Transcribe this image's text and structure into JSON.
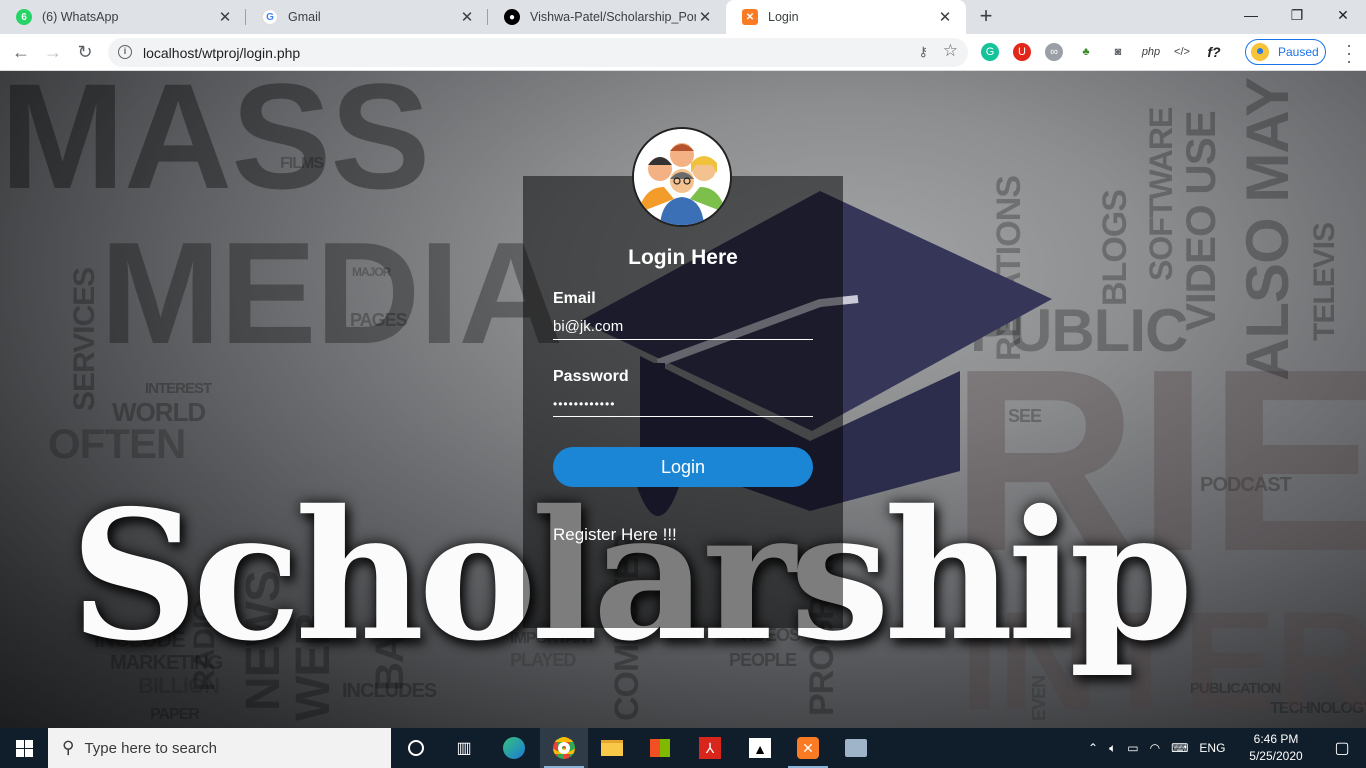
{
  "tabs": [
    {
      "title": "(6) WhatsApp",
      "icon": "whatsapp-icon",
      "badge": "6",
      "color": "#25d366"
    },
    {
      "title": "Gmail",
      "icon": "google-icon",
      "color": "#ffffff"
    },
    {
      "title": "Vishwa-Patel/Scholarship_Portal:",
      "icon": "github-icon",
      "color": "#000000"
    },
    {
      "title": "Login",
      "icon": "xampp-icon",
      "color": "#fb7a24"
    }
  ],
  "window": {
    "minimize": "—",
    "maximize": "❐",
    "close": "✕",
    "new_tab": "+"
  },
  "toolbar": {
    "url": "localhost/wtproj/login.php",
    "paused_label": "Paused",
    "extensions": [
      "grammarly-icon",
      "ublock-icon",
      "link-icon",
      "tree-icon",
      "camera-icon",
      "php",
      "code-icon",
      "f?"
    ]
  },
  "login": {
    "title": "Login Here",
    "email_label": "Email",
    "email_value": "bi@jk.com",
    "password_label": "Password",
    "password_value": "••••••••••••",
    "button_label": "Login",
    "register_link": "Register Here !!!"
  },
  "banner": {
    "text": "Scholarship"
  },
  "colors": {
    "login_button": "#1b86d6",
    "hat": "#363659",
    "taskbar": "#101d2a"
  },
  "taskbar": {
    "search_placeholder": "Type here to search",
    "apps": [
      "cortana-icon",
      "task-view-icon",
      "edge-icon",
      "chrome-icon",
      "file-explorer-icon",
      "store-icon",
      "acrobat-icon",
      "photos-icon",
      "xampp-icon",
      "network-icon"
    ],
    "language": "ENG",
    "time": "6:46 PM",
    "date": "5/25/2020"
  }
}
